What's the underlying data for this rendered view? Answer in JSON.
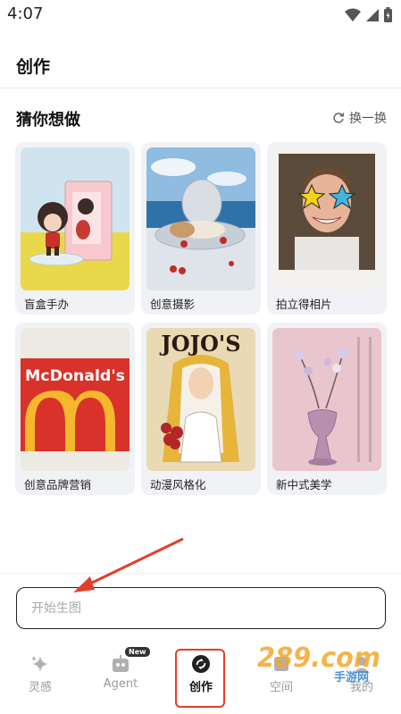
{
  "status_bar": {
    "time": "4:07"
  },
  "header": {
    "title": "创作"
  },
  "section": {
    "title": "猜你想做",
    "refresh_label": "换一换"
  },
  "cards": [
    {
      "label": "盲盒手办"
    },
    {
      "label": "创意摄影"
    },
    {
      "label": "拍立得相片"
    },
    {
      "label": "创意品牌营销",
      "image_text": "McDonald's"
    },
    {
      "label": "动漫风格化",
      "image_text": "JOJO'S"
    },
    {
      "label": "新中式美学"
    }
  ],
  "prompt": {
    "placeholder": "开始生图"
  },
  "nav": {
    "items": [
      {
        "label": "灵感"
      },
      {
        "label": "Agent",
        "badge": "New"
      },
      {
        "label": "创作"
      },
      {
        "label": "空间"
      },
      {
        "label": "我的"
      }
    ],
    "active": "创作"
  },
  "watermark": {
    "text": "289.com",
    "subtext": "手游网"
  },
  "colors": {
    "accent_red": "#e0402a",
    "card_bg": "#f1f2f5",
    "border_dark": "#222222"
  }
}
